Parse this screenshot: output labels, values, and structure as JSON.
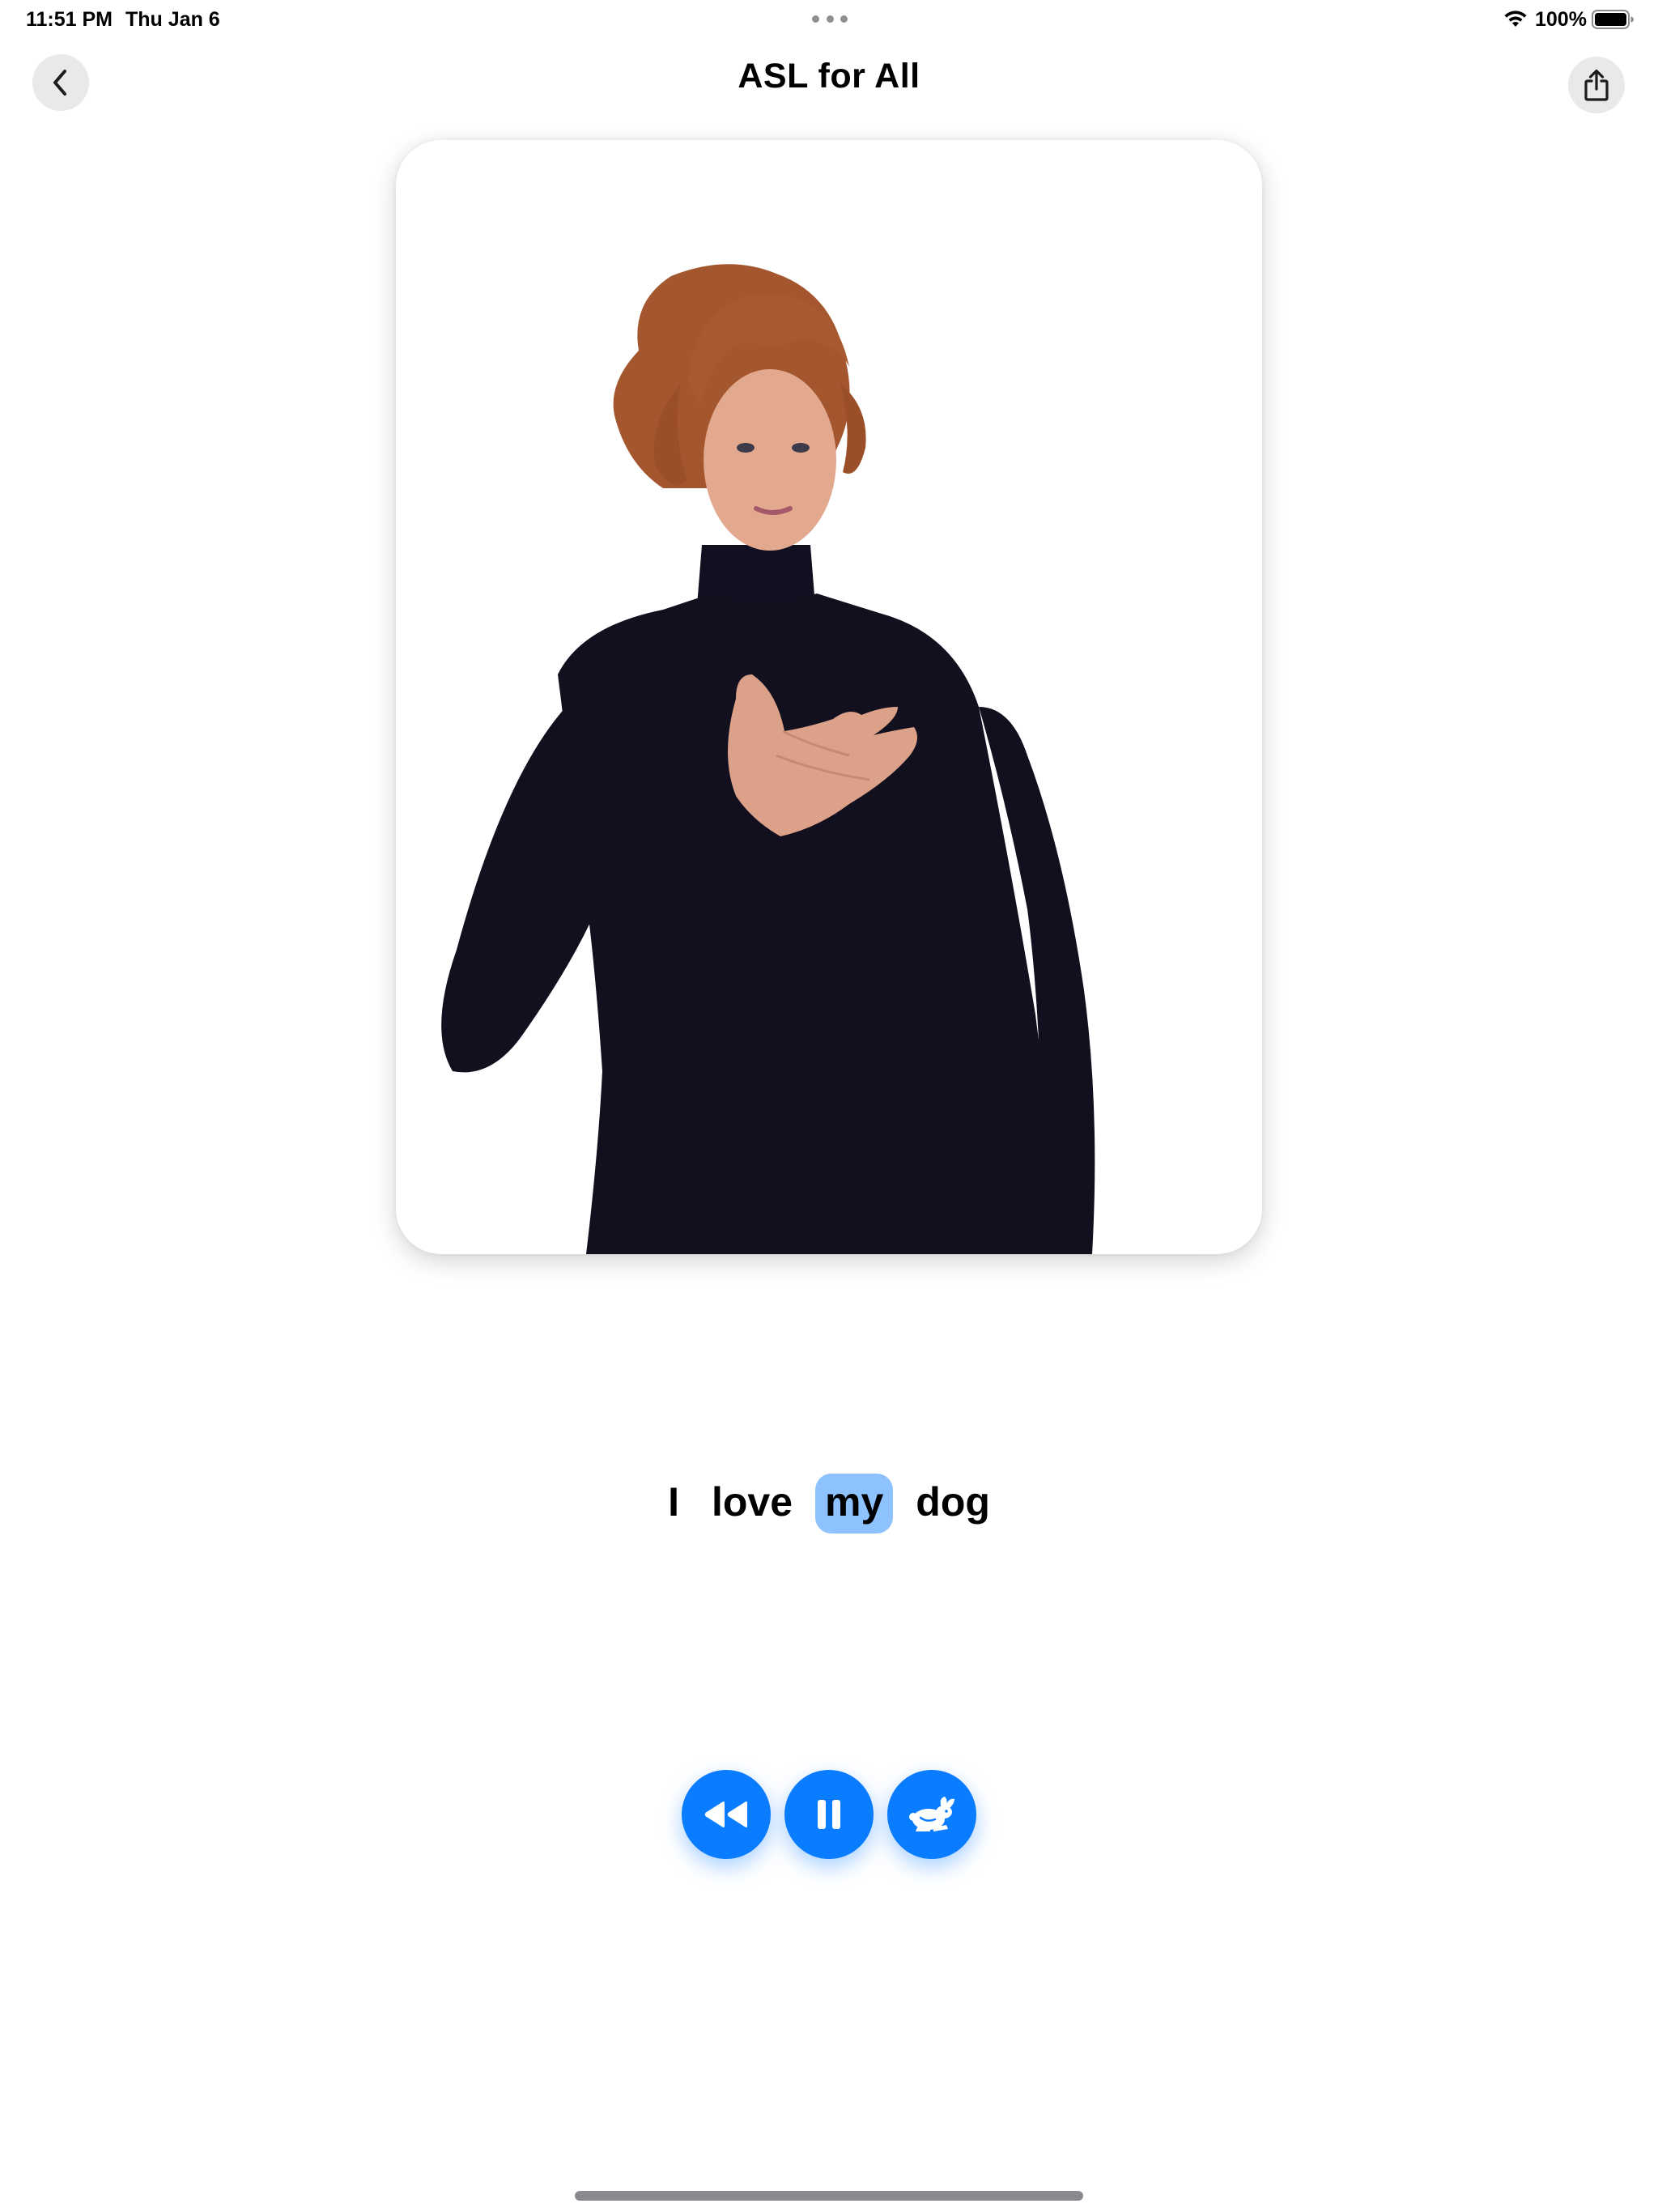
{
  "status_bar": {
    "time": "11:51 PM",
    "date": "Thu Jan 6",
    "battery_percent": "100%",
    "wifi_icon": "wifi-icon",
    "battery_icon": "battery-full-icon",
    "multitask_icon": "ellipsis-icon"
  },
  "nav": {
    "title": "ASL for All",
    "back_icon": "chevron-left-icon",
    "share_icon": "share-icon"
  },
  "video": {
    "content_icon": "signer-video"
  },
  "sentence": {
    "words": [
      "I",
      "love",
      "my",
      "dog"
    ],
    "highlighted_index": 2,
    "highlight_color": "#8ec2ff"
  },
  "controls": {
    "rewind_icon": "rewind-icon",
    "pause_icon": "pause-icon",
    "speed_icon": "rabbit-icon",
    "accent_color": "#0a7cff"
  }
}
